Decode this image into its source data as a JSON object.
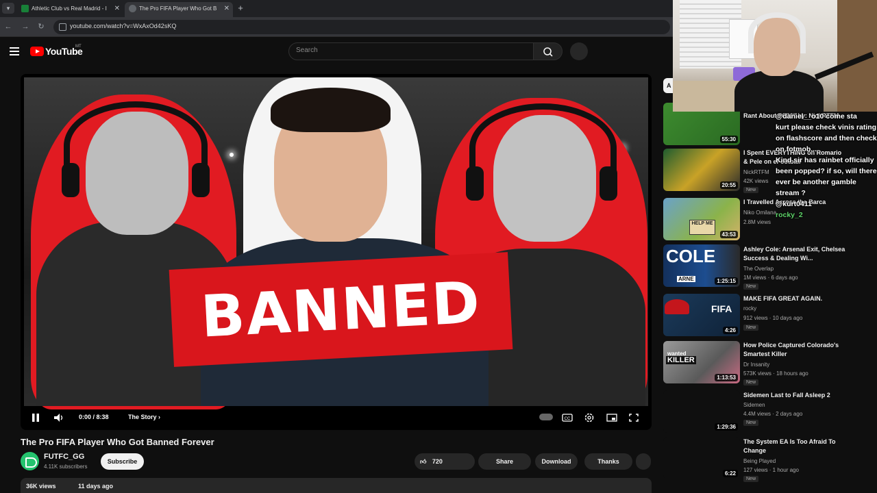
{
  "browser": {
    "tabs": [
      {
        "title": "Athletic Club vs Real Madrid - I",
        "active": false
      },
      {
        "title": "The Pro FIFA Player Who Got B",
        "active": true
      }
    ],
    "url": "youtube.com/watch?v=WxAxOd42sKQ"
  },
  "header": {
    "logo_text": "YouTube",
    "country": "MT",
    "search_placeholder": "Search"
  },
  "player": {
    "thumbnail_text": "BANNED",
    "time": "0:00 / 8:38",
    "chapter": "The Story",
    "progress": 0
  },
  "video": {
    "title": "The Pro FIFA Player Who Got Banned Forever",
    "channel": "FUTFC_GG",
    "subscribers": "4.11K subscribers",
    "subscribe_label": "Subscribe",
    "likes": "720",
    "share_label": "Share",
    "download_label": "Download",
    "thanks_label": "Thanks",
    "views": "36K views",
    "age": "11 days ago"
  },
  "sidebar": {
    "chip": "A",
    "items": [
      {
        "title": "Rant About FC26\" by: NickRTFM",
        "channel": "",
        "meta": "",
        "duration": "55:30",
        "new": ""
      },
      {
        "title": "I Spent EVERYTHING on Romario & Pele on eFootball",
        "channel": "NickRTFM",
        "meta": "42K views",
        "duration": "20:55",
        "new": "New"
      },
      {
        "title": "I Travelled Across the Barca",
        "channel": "Niko Omilana",
        "meta": "2.8M views",
        "duration": "43:53",
        "new": ""
      },
      {
        "title": "Ashley Cole: Arsenal Exit, Chelsea Success & Dealing Wi...",
        "channel": "The Overlap",
        "meta": "1M views · 6 days ago",
        "duration": "1:25:15",
        "new": "New"
      },
      {
        "title": "MAKE FIFA GREAT AGAIN.",
        "channel": "rocky",
        "meta": "912 views · 10 days ago",
        "duration": "4:26",
        "new": "New"
      },
      {
        "title": "How Police Captured Colorado's Smartest Killer",
        "channel": "Dr Insanity",
        "meta": "573K views · 18 hours ago",
        "duration": "1:13:53",
        "new": "New"
      },
      {
        "title": "Sidemen Last to Fall Asleep 2",
        "channel": "Sidemen",
        "meta": "4.4M views · 2 days ago",
        "duration": "1:29:36",
        "new": "New"
      },
      {
        "title": "The System EA Is Too Afraid To Change",
        "channel": "Being Played",
        "meta": "127 views · 1 hour ago",
        "duration": "6:22",
        "new": "New"
      }
    ],
    "thumb_overlays": {
      "cole": "COLE",
      "arne": "ARNE",
      "help": "HELP ME",
      "fifa": "FIFA",
      "wanted": "wanted",
      "killer": "KILLER"
    }
  },
  "chat": {
    "messages": [
      {
        "user": "",
        "text": "@daniel__o10 come sta"
      },
      {
        "user": "",
        "text": "kurt please check vinis rating on flashscore and then check on fotmob,.."
      },
      {
        "user": "",
        "text": "Kind sir has rainbet officially been popped? if so, will there ever be another gamble stream ?"
      },
      {
        "user": "",
        "text": "@kurt0411"
      },
      {
        "user": "rocky_2",
        "text": ""
      }
    ]
  },
  "colors": {
    "background": "#0f0f0f",
    "accent_red": "#ff0000",
    "banner_red": "#d9161c",
    "avatar_green": "#24c36e"
  }
}
